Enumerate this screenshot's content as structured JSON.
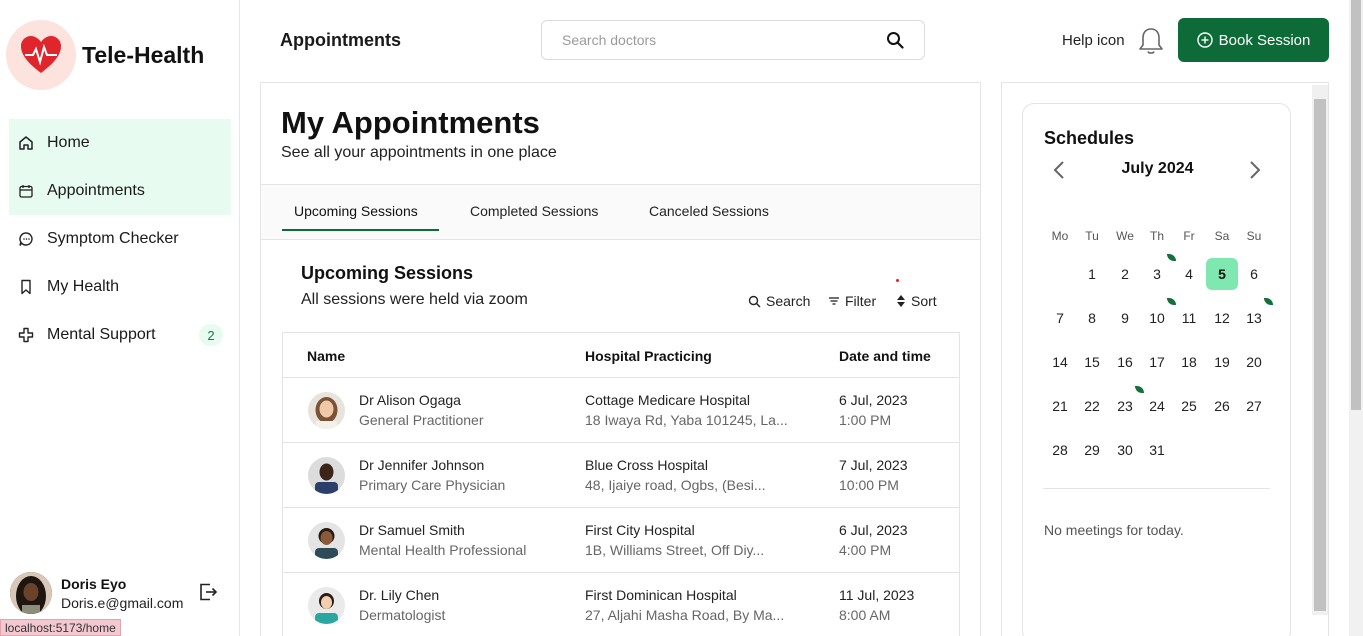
{
  "app": {
    "name": "Tele-Health"
  },
  "sidebar": {
    "items": [
      {
        "label": "Home",
        "icon": "home-icon",
        "active": true
      },
      {
        "label": "Appointments",
        "icon": "calendar-icon",
        "active": true
      },
      {
        "label": "Symptom Checker",
        "icon": "chat-icon",
        "active": false
      },
      {
        "label": "My Health",
        "icon": "bookmark-icon",
        "active": false
      },
      {
        "label": "Mental Support",
        "icon": "cross-icon",
        "active": false,
        "badge": "2"
      }
    ],
    "user": {
      "name": "Doris Eyo",
      "email": "Doris.e@gmail.com"
    },
    "status_url": "localhost:5173/home"
  },
  "header": {
    "title": "Appointments",
    "search_placeholder": "Search doctors",
    "help_label": "Help icon",
    "book_label": "Book Session"
  },
  "main": {
    "title": "My Appointments",
    "subtitle": "See all your appointments in one place",
    "tabs": [
      "Upcoming Sessions",
      "Completed Sessions",
      "Canceled Sessions"
    ],
    "active_tab": "Upcoming Sessions",
    "section_title": "Upcoming Sessions",
    "section_sub": "All sessions were held via zoom",
    "tools": {
      "search": "Search",
      "filter": "Filter",
      "sort": "Sort"
    },
    "table": {
      "headers": [
        "Name",
        "Hospital Practicing",
        "Date and time"
      ],
      "rows": [
        {
          "name": "Dr Alison Ogaga",
          "role": "General Practitioner",
          "hospital": "Cottage Medicare Hospital",
          "address": "18 Iwaya Rd, Yaba 101245, La...",
          "date": "6 Jul, 2023",
          "time": "1:00 PM"
        },
        {
          "name": "Dr Jennifer Johnson",
          "role": "Primary Care Physician",
          "hospital": "Blue Cross Hospital",
          "address": "48, Ijaiye road, Ogbs, (Besi...",
          "date": "7 Jul, 2023",
          "time": "10:00 PM"
        },
        {
          "name": "Dr Samuel Smith",
          "role": "Mental Health Professional",
          "hospital": "First City Hospital",
          "address": "1B, Williams Street, Off Diy...",
          "date": "6 Jul, 2023",
          "time": "4:00 PM"
        },
        {
          "name": "Dr. Lily Chen",
          "role": "Dermatologist",
          "hospital": "First Dominican Hospital",
          "address": "27, Aljahi Masha Road, By Ma...",
          "date": "11 Jul, 2023",
          "time": "8:00 AM"
        }
      ]
    }
  },
  "schedule": {
    "title": "Schedules",
    "month": "July 2024",
    "weekdays": [
      "Mo",
      "Tu",
      "We",
      "Th",
      "Fr",
      "Sa",
      "Su"
    ],
    "first_weekday_index": 1,
    "days_in_month": 31,
    "today": 5,
    "marked_days": [
      3,
      10,
      13,
      23
    ],
    "empty_text": "No meetings for today."
  },
  "colors": {
    "brand": "#0c6b36",
    "active_nav": "#e7fbf0",
    "today": "#7ee8b0",
    "logo_bg": "#fde3dd",
    "heart": "#e0262c"
  }
}
